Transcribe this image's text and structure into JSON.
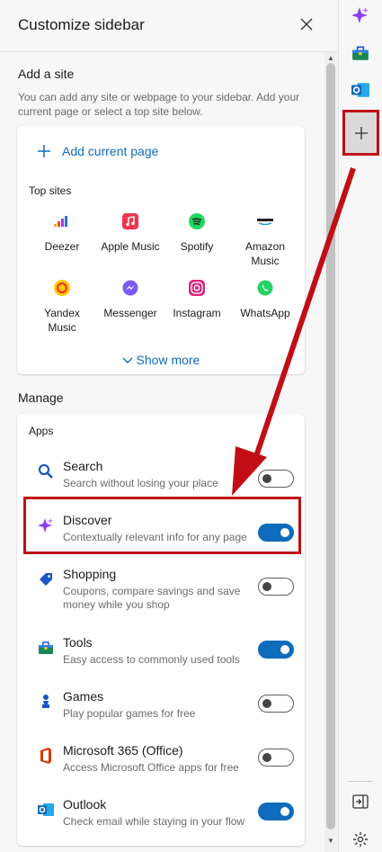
{
  "panel": {
    "title": "Customize sidebar"
  },
  "add_site": {
    "heading": "Add a site",
    "description": "You can add any site or webpage to your sidebar. Add your current page or select a top site below.",
    "add_current_label": "Add current page",
    "top_sites_label": "Top sites",
    "sites": [
      {
        "name": "Deezer",
        "icon": "deezer-icon"
      },
      {
        "name": "Apple Music",
        "icon": "apple-music-icon"
      },
      {
        "name": "Spotify",
        "icon": "spotify-icon"
      },
      {
        "name": "Amazon Music",
        "icon": "amazon-music-icon"
      },
      {
        "name": "Yandex Music",
        "icon": "yandex-music-icon"
      },
      {
        "name": "Messenger",
        "icon": "messenger-icon"
      },
      {
        "name": "Instagram",
        "icon": "instagram-icon"
      },
      {
        "name": "WhatsApp",
        "icon": "whatsapp-icon"
      }
    ],
    "show_more_label": "Show more"
  },
  "manage": {
    "heading": "Manage",
    "apps_label": "Apps",
    "apps": [
      {
        "name": "Search",
        "desc": "Search without losing your place",
        "enabled": false,
        "icon": "search-icon"
      },
      {
        "name": "Discover",
        "desc": "Contextually relevant info for any page",
        "enabled": true,
        "icon": "discover-icon"
      },
      {
        "name": "Shopping",
        "desc": "Coupons, compare savings and save money while you shop",
        "enabled": false,
        "icon": "shopping-tag-icon"
      },
      {
        "name": "Tools",
        "desc": "Easy access to commonly used tools",
        "enabled": true,
        "icon": "toolbox-icon"
      },
      {
        "name": "Games",
        "desc": "Play popular games for free",
        "enabled": false,
        "icon": "games-icon"
      },
      {
        "name": "Microsoft 365 (Office)",
        "desc": "Access Microsoft Office apps for free",
        "enabled": false,
        "icon": "office-icon"
      },
      {
        "name": "Outlook",
        "desc": "Check email while staying in your flow",
        "enabled": true,
        "icon": "outlook-icon"
      }
    ]
  },
  "rail": {
    "icons": [
      "discover-icon",
      "toolbox-icon",
      "outlook-icon",
      "add-icon",
      "split-screen-icon",
      "settings-icon"
    ]
  },
  "colors": {
    "accent": "#0f6cbd",
    "annotation": "#c10e16"
  }
}
